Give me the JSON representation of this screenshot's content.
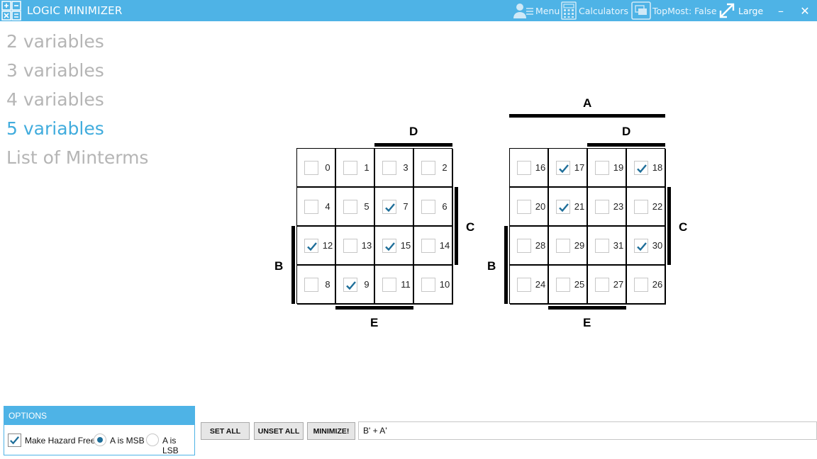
{
  "window": {
    "title": "LOGIC MINIMIZER",
    "menu_label": "Menu",
    "calculators_label": "Calculators",
    "topmost_label": "TopMost: False",
    "size_label": "Large",
    "minimize_glyph": "–",
    "close_glyph": "✕"
  },
  "nav": {
    "items": [
      "2 variables",
      "3 variables",
      "4 variables",
      "5 variables",
      "List of Minterms"
    ],
    "active_index": 3
  },
  "kmap_labels": {
    "a": "A",
    "b": "B",
    "c": "C",
    "d": "D",
    "e": "E"
  },
  "kmaps": [
    {
      "cells": [
        [
          {
            "n": "0",
            "checked": false
          },
          {
            "n": "1",
            "checked": false
          },
          {
            "n": "3",
            "checked": false
          },
          {
            "n": "2",
            "checked": false
          }
        ],
        [
          {
            "n": "4",
            "checked": false
          },
          {
            "n": "5",
            "checked": false
          },
          {
            "n": "7",
            "checked": true
          },
          {
            "n": "6",
            "checked": false
          }
        ],
        [
          {
            "n": "12",
            "checked": true
          },
          {
            "n": "13",
            "checked": false
          },
          {
            "n": "15",
            "checked": true
          },
          {
            "n": "14",
            "checked": false
          }
        ],
        [
          {
            "n": "8",
            "checked": false
          },
          {
            "n": "9",
            "checked": true
          },
          {
            "n": "11",
            "checked": false
          },
          {
            "n": "10",
            "checked": false
          }
        ]
      ]
    },
    {
      "cells": [
        [
          {
            "n": "16",
            "checked": false
          },
          {
            "n": "17",
            "checked": true
          },
          {
            "n": "19",
            "checked": false
          },
          {
            "n": "18",
            "checked": true
          }
        ],
        [
          {
            "n": "20",
            "checked": false
          },
          {
            "n": "21",
            "checked": true
          },
          {
            "n": "23",
            "checked": false
          },
          {
            "n": "22",
            "checked": false
          }
        ],
        [
          {
            "n": "28",
            "checked": false
          },
          {
            "n": "29",
            "checked": false
          },
          {
            "n": "31",
            "checked": false
          },
          {
            "n": "30",
            "checked": true
          }
        ],
        [
          {
            "n": "24",
            "checked": false
          },
          {
            "n": "25",
            "checked": false
          },
          {
            "n": "27",
            "checked": false
          },
          {
            "n": "26",
            "checked": false
          }
        ]
      ]
    }
  ],
  "options": {
    "header": "OPTIONS",
    "hazard_free_label": "Make Hazard Free",
    "hazard_free_checked": true,
    "msb_label": "A is MSB",
    "lsb_label": "A is LSB",
    "msb_selected": true
  },
  "buttons": {
    "set_all": "SET ALL",
    "unset_all": "UNSET ALL",
    "minimize": "MINIMIZE!"
  },
  "result": {
    "expression": "B' + A'"
  },
  "colors": {
    "accent": "#4eb3e6",
    "active_nav": "#41acdd",
    "inactive_nav": "#b5b5b5",
    "check": "#1e6e99"
  }
}
